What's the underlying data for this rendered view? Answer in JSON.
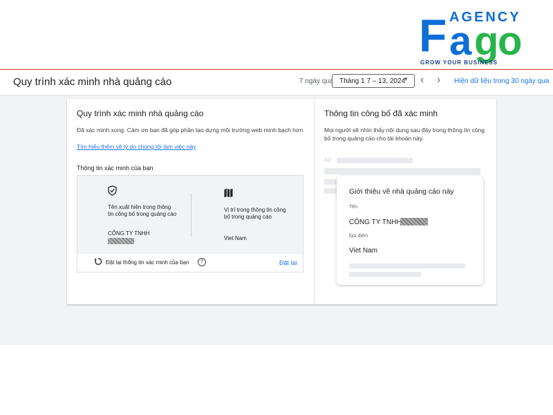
{
  "logo": {
    "agency": "AGENCY",
    "letter_f": "F",
    "letter_a": "a",
    "letter_g": "g",
    "letter_o": "o",
    "tagline": "GROW YOUR BUSINESS",
    "colors": {
      "blue": "#0c6ed6",
      "green": "#27b54a"
    }
  },
  "header": {
    "title": "Quy trình xác minh nhà quảng cáo",
    "range_label": "7 ngày qua",
    "date_range": "Tháng 1 7 – 13, 2024",
    "show_30_days": "Hiện dữ liệu trong 30 ngày qua"
  },
  "left": {
    "title": "Quy trình xác minh nhà quảng cáo",
    "description": "Đã xác minh xong. Cảm ơn bạn đã góp phần tạo dựng môi trường web minh bạch hơn",
    "learn_more": "Tìm hiểu thêm về lý do chúng tôi làm việc này",
    "subtitle": "Thông tin xác minh của bạn",
    "name_item": {
      "label": "Tên xuất hiện trong thông tin công bố trong quảng cáo",
      "value": "CÔNG TY TNHH"
    },
    "location_item": {
      "label": "Vị trí trong thông tin công bố trong quảng cáo",
      "value": "Viet Nam"
    },
    "reset_label": "Đặt lại thông tin xác minh của bạn",
    "help": "?",
    "reset_button": "Đặt lại"
  },
  "right": {
    "title": "Thông tin công bố đã xác minh",
    "description": "Mọi người sẽ nhìn thấy nội dung sau đây trong thông tin công bố trong quảng cáo cho tài khoản này.",
    "ad_label": "Ad",
    "popup": {
      "title": "Giới thiệu về nhà quảng cáo này",
      "name_label": "Tên",
      "company": "CÔNG TY TNHH",
      "location_label": "Địa điểm",
      "country": "Viet Nam"
    }
  },
  "colors": {
    "link": "#1a73e8",
    "accent_line": "#d93025",
    "background": "#f1f3f4"
  },
  "icons": {
    "shield": "shield-check-icon",
    "map": "map-icon",
    "reset": "reset-icon",
    "prev": "chevron-left-icon",
    "next": "chevron-right-icon",
    "caret": "caret-down-icon"
  }
}
